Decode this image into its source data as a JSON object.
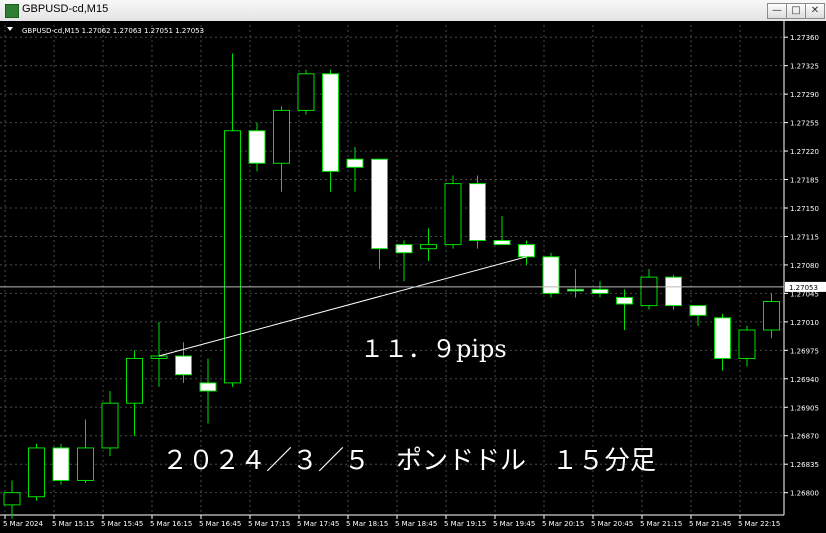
{
  "window": {
    "title": "GBPUSD-cd,M15",
    "btn_minimize": "—",
    "btn_maximize": "□",
    "btn_close": "✕"
  },
  "colors": {
    "background": "#000000",
    "grid": "#4a4a4a",
    "bull_candle": "#000000",
    "bear_candle": "#ffffff",
    "wick": "#00e000",
    "trendline": "#ffffff",
    "text": "#ffffff",
    "price_label_bg": "#ffffff",
    "price_label_text": "#000000"
  },
  "chart_data": {
    "type": "candlestick",
    "symbol_header": "GBPUSD-cd,M15  1.27062 1.27063 1.27051 1.27053",
    "current_price_label": "1.27053",
    "current_price": 1.27053,
    "y_ticks": [
      "1.27360",
      "1.27325",
      "1.27290",
      "1.27255",
      "1.27220",
      "1.27185",
      "1.27150",
      "1.27115",
      "1.27080",
      "1.27045",
      "1.27010",
      "1.26975",
      "1.26940",
      "1.26905",
      "1.26870",
      "1.26835",
      "1.26800"
    ],
    "x_ticks": [
      "5 Mar 2024",
      "5 Mar 15:15",
      "5 Mar 15:45",
      "5 Mar 16:15",
      "5 Mar 16:45",
      "5 Mar 17:15",
      "5 Mar 17:45",
      "5 Mar 18:15",
      "5 Mar 18:45",
      "5 Mar 19:15",
      "5 Mar 19:45",
      "5 Mar 20:15",
      "5 Mar 20:45",
      "5 Mar 21:15",
      "5 Mar 21:45",
      "5 Mar 22:15"
    ],
    "ylim": [
      1.26775,
      1.27375
    ],
    "candles": [
      {
        "o": 1.26785,
        "h": 1.26815,
        "l": 1.26768,
        "c": 1.268
      },
      {
        "o": 1.26795,
        "h": 1.2686,
        "l": 1.2679,
        "c": 1.26855
      },
      {
        "o": 1.26855,
        "h": 1.2686,
        "l": 1.2681,
        "c": 1.26815
      },
      {
        "o": 1.26815,
        "h": 1.2689,
        "l": 1.26812,
        "c": 1.26855
      },
      {
        "o": 1.26855,
        "h": 1.26925,
        "l": 1.26845,
        "c": 1.2691
      },
      {
        "o": 1.2691,
        "h": 1.26975,
        "l": 1.2687,
        "c": 1.26965
      },
      {
        "o": 1.26965,
        "h": 1.2701,
        "l": 1.2693,
        "c": 1.26968
      },
      {
        "o": 1.26968,
        "h": 1.26985,
        "l": 1.26935,
        "c": 1.26945
      },
      {
        "o": 1.26935,
        "h": 1.26965,
        "l": 1.26885,
        "c": 1.26925
      },
      {
        "o": 1.26935,
        "h": 1.2734,
        "l": 1.2693,
        "c": 1.27245
      },
      {
        "o": 1.27245,
        "h": 1.27255,
        "l": 1.27195,
        "c": 1.27205
      },
      {
        "o": 1.27205,
        "h": 1.27275,
        "l": 1.2717,
        "c": 1.2727
      },
      {
        "o": 1.2727,
        "h": 1.2732,
        "l": 1.27265,
        "c": 1.27315
      },
      {
        "o": 1.27315,
        "h": 1.2732,
        "l": 1.2717,
        "c": 1.27195
      },
      {
        "o": 1.2721,
        "h": 1.27225,
        "l": 1.2717,
        "c": 1.272
      },
      {
        "o": 1.2721,
        "h": 1.2721,
        "l": 1.27075,
        "c": 1.271
      },
      {
        "o": 1.27105,
        "h": 1.2711,
        "l": 1.2706,
        "c": 1.27095
      },
      {
        "o": 1.271,
        "h": 1.27125,
        "l": 1.27085,
        "c": 1.27105
      },
      {
        "o": 1.27105,
        "h": 1.2719,
        "l": 1.271,
        "c": 1.2718
      },
      {
        "o": 1.2718,
        "h": 1.2719,
        "l": 1.271,
        "c": 1.2711
      },
      {
        "o": 1.2711,
        "h": 1.2714,
        "l": 1.27105,
        "c": 1.27105
      },
      {
        "o": 1.27105,
        "h": 1.2711,
        "l": 1.2708,
        "c": 1.2709
      },
      {
        "o": 1.2709,
        "h": 1.27095,
        "l": 1.2704,
        "c": 1.27045
      },
      {
        "o": 1.2705,
        "h": 1.27075,
        "l": 1.2704,
        "c": 1.27048
      },
      {
        "o": 1.2705,
        "h": 1.2706,
        "l": 1.2704,
        "c": 1.27045
      },
      {
        "o": 1.2704,
        "h": 1.2705,
        "l": 1.27,
        "c": 1.27032
      },
      {
        "o": 1.2703,
        "h": 1.27075,
        "l": 1.27025,
        "c": 1.27065
      },
      {
        "o": 1.27065,
        "h": 1.27068,
        "l": 1.27025,
        "c": 1.2703
      },
      {
        "o": 1.2703,
        "h": 1.2703,
        "l": 1.27005,
        "c": 1.27018
      },
      {
        "o": 1.27015,
        "h": 1.2702,
        "l": 1.2695,
        "c": 1.26965
      },
      {
        "o": 1.26965,
        "h": 1.27005,
        "l": 1.26955,
        "c": 1.27
      },
      {
        "o": 1.27,
        "h": 1.27045,
        "l": 1.2699,
        "c": 1.27035
      }
    ],
    "trendline": {
      "from_index": 6,
      "from_price": 1.26968,
      "to_index": 21,
      "to_price": 1.2709
    },
    "annotations": {
      "pips_label": "１１．９pips",
      "date_label": "２０２４／３／５　ポンドドル　１５分足"
    }
  }
}
